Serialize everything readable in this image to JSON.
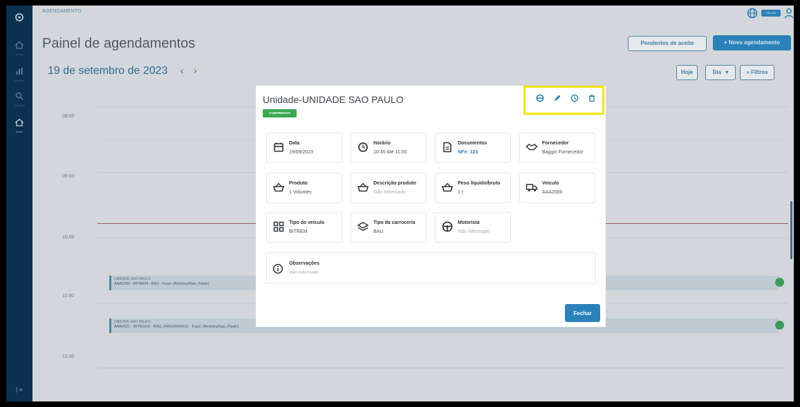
{
  "app": {
    "breadcrumb": "AGENDAMENTO",
    "page_title": "Painel de agendamentos",
    "status": "ONLINE"
  },
  "sidebar": {
    "items": [
      {
        "icon": "settings-icon",
        "label": ""
      },
      {
        "icon": "home-icon",
        "label": "Início"
      },
      {
        "icon": "chart-icon",
        "label": "Gráficos"
      },
      {
        "icon": "search-icon",
        "label": "Consulta"
      },
      {
        "icon": "home-icon",
        "label": "Início"
      },
      {
        "icon": "logout-icon",
        "label": ""
      }
    ]
  },
  "header": {
    "pending_label": "Pendentes de aceite",
    "new_label": "+ Novo agendamento",
    "date": "19 de setembro de 2023",
    "prev": "‹",
    "next": "›",
    "today_label": "Hoje",
    "view_label": "Dia",
    "filters_label": "» Filtros"
  },
  "calendar": {
    "times": [
      "08:00",
      "09:00",
      "10:00",
      "11:00",
      "12:00"
    ],
    "events": [
      {
        "unit": "UNIDADE SAO PAULO",
        "detail": "AAA2000 - BITREM - BAU - Fuso: (America/Sao_Paulo)"
      },
      {
        "unit": "UNIDADE SAO PAULO",
        "detail": "AAA2021 - BITRUCK - BAU_FRIGORIFICO - Fuso: (America/Sao_Paulo)"
      }
    ]
  },
  "modal": {
    "title": "Unidade-UNIDADE SAO PAULO",
    "badge": "CONFIRMADO",
    "actions": [
      "printer-icon",
      "edit-icon",
      "clock-icon",
      "trash-icon"
    ],
    "cards": [
      {
        "label": "Data",
        "value": "19/09/2023",
        "icon": "calendar-icon"
      },
      {
        "label": "Horário",
        "value": "10:45 Até 11:00",
        "icon": "clock-icon"
      },
      {
        "label": "Documentos",
        "value": "NFe: 123",
        "icon": "document-icon"
      },
      {
        "label": "Fornecedor",
        "value": "Baggio Fornecedor",
        "icon": "handshake-icon"
      },
      {
        "label": "Produto",
        "value": "1 Volumes",
        "icon": "basket-icon"
      },
      {
        "label": "Descrição produto",
        "value": "Não Informado",
        "icon": "basket-icon"
      },
      {
        "label": "Peso líquido/bruto",
        "value": "1 t",
        "icon": "basket-icon"
      },
      {
        "label": "Veículo",
        "value": "AAA2000",
        "icon": "truck-icon"
      },
      {
        "label": "Tipo do veículo",
        "value": "BITREM",
        "icon": "grid-icon"
      },
      {
        "label": "Tipo da carroceria",
        "value": "BAU",
        "icon": "layers-icon"
      },
      {
        "label": "Motorista",
        "value": "Não Informado",
        "icon": "steering-wheel-icon"
      }
    ],
    "observations_label": "Observações",
    "observations_value": "Não Informado",
    "close_label": "Fechar"
  }
}
